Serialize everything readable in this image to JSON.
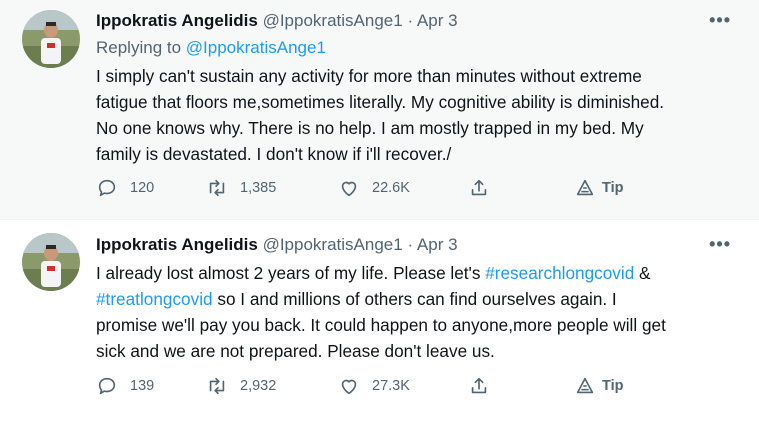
{
  "tweets": [
    {
      "name": "Ippokratis Angelidis",
      "handle": "@IppokratisAnge1",
      "dot": "·",
      "date": "Apr 3",
      "more": "•••",
      "reply_prefix": "Replying to",
      "reply_handle": "@IppokratisAnge1",
      "text_lines": [
        "I simply can't sustain any activity for more than minutes without extreme",
        "fatigue that floors me,sometimes literally. My cognitive ability is diminished.",
        "No one knows why. There is no help. I am mostly trapped in my bed. My",
        "family is devastated. I don't know if i'll recover./"
      ],
      "replies": "120",
      "retweets": "1,385",
      "likes": "22.6K",
      "tip": "Tip"
    },
    {
      "name": "Ippokratis Angelidis",
      "handle": "@IppokratisAnge1",
      "dot": "·",
      "date": "Apr 3",
      "more": "•••",
      "line1_pre": "I already lost almost 2 years of my life. Please let's ",
      "line1_tag": "#researchlongcovid",
      "line1_post": " &",
      "line2_tag": "#treatlongcovid",
      "line2_post": " so I and millions of others can find ourselves again. I",
      "line3": "promise we'll pay you back. It could happen to anyone,more people will get",
      "line4": "sick and we are not prepared. Please don't leave us.",
      "replies": "139",
      "retweets": "2,932",
      "likes": "27.3K",
      "tip": "Tip"
    }
  ],
  "colors": {
    "link": "#1d9bf0",
    "muted": "#536471",
    "text": "#0f1419",
    "first_bg": "#f7f9f9"
  }
}
